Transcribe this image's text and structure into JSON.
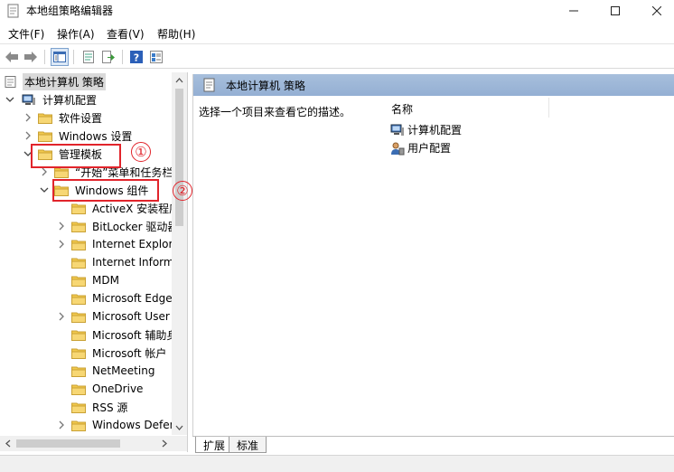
{
  "window": {
    "title": "本地组策略编辑器",
    "controls": [
      "minimize",
      "maximize",
      "close"
    ]
  },
  "menubar": {
    "items": [
      "文件(F)",
      "操作(A)",
      "查看(V)",
      "帮助(H)"
    ]
  },
  "toolbar": {
    "buttons": [
      "back-arrow-icon",
      "forward-arrow-icon",
      "show-tree-icon",
      "properties-icon",
      "export-list-icon",
      "help-icon",
      "view-icon"
    ]
  },
  "tree": {
    "items": [
      {
        "label": "本地计算机 策略",
        "expander": "none",
        "icon": "policy-icon",
        "selected": true
      },
      {
        "label": "计算机配置",
        "expander": "expanded",
        "icon": "computer-icon"
      },
      {
        "label": "软件设置",
        "expander": "collapsed",
        "icon": "folder-icon"
      },
      {
        "label": "Windows 设置",
        "expander": "collapsed",
        "icon": "folder-icon"
      },
      {
        "label": "管理模板",
        "expander": "expanded",
        "icon": "folder-icon"
      },
      {
        "label": "“开始”菜单和任务栏",
        "expander": "collapsed",
        "icon": "folder-icon"
      },
      {
        "label": "Windows 组件",
        "expander": "expanded",
        "icon": "folder-icon"
      },
      {
        "label": "ActiveX 安装程序服务",
        "expander": "none",
        "icon": "folder-icon"
      },
      {
        "label": "BitLocker 驱动器加密",
        "expander": "collapsed",
        "icon": "folder-icon"
      },
      {
        "label": "Internet Explorer",
        "expander": "collapsed",
        "icon": "folder-icon"
      },
      {
        "label": "Internet Information Services",
        "expander": "none",
        "icon": "folder-icon"
      },
      {
        "label": "MDM",
        "expander": "none",
        "icon": "folder-icon"
      },
      {
        "label": "Microsoft Edge",
        "expander": "none",
        "icon": "folder-icon"
      },
      {
        "label": "Microsoft User Experience Virtualization",
        "expander": "collapsed",
        "icon": "folder-icon"
      },
      {
        "label": "Microsoft 辅助身份验证因素",
        "expander": "none",
        "icon": "folder-icon"
      },
      {
        "label": "Microsoft 帐户",
        "expander": "none",
        "icon": "folder-icon"
      },
      {
        "label": "NetMeeting",
        "expander": "none",
        "icon": "folder-icon"
      },
      {
        "label": "OneDrive",
        "expander": "none",
        "icon": "folder-icon"
      },
      {
        "label": "RSS 源",
        "expander": "none",
        "icon": "folder-icon"
      },
      {
        "label": "Windows Defender",
        "expander": "collapsed",
        "icon": "folder-icon"
      }
    ]
  },
  "right_pane": {
    "header": "本地计算机 策略",
    "description": "选择一个项目来查看它的描述。",
    "column_header": "名称",
    "items": [
      {
        "label": "计算机配置",
        "icon": "computer-icon"
      },
      {
        "label": "用户配置",
        "icon": "user-icon"
      }
    ]
  },
  "tabs": [
    "扩展",
    "标准"
  ],
  "annotations": [
    {
      "number": "①",
      "color": "#e1242b"
    },
    {
      "number": "②",
      "color": "#e1242b"
    }
  ],
  "colors": {
    "annotation": "#e1242b",
    "header_bg": "#a7bfdc",
    "selection_bg": "#d9d9d9",
    "folder": "#f2c94c"
  }
}
